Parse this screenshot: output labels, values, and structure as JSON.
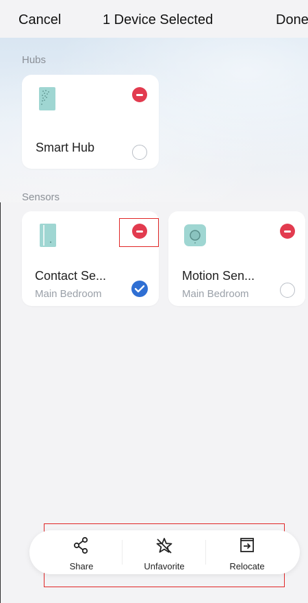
{
  "header": {
    "cancel_label": "Cancel",
    "title": "1 Device Selected",
    "done_label": "Done"
  },
  "sections": {
    "hubs_label": "Hubs",
    "sensors_label": "Sensors"
  },
  "devices": [
    {
      "name": "Smart Hub",
      "room": "",
      "selected": false,
      "icon": "hub-icon"
    },
    {
      "name": "Contact Se...",
      "room": "Main Bedroom",
      "selected": true,
      "icon": "contact-sensor-icon"
    },
    {
      "name": "Motion Sen...",
      "room": "Main Bedroom",
      "selected": false,
      "icon": "motion-sensor-icon"
    }
  ],
  "actions": [
    {
      "label": "Share",
      "icon": "share-icon"
    },
    {
      "label": "Unfavorite",
      "icon": "unfavorite-star-icon"
    },
    {
      "label": "Relocate",
      "icon": "relocate-icon"
    }
  ],
  "colors": {
    "remove": "#e23b4f",
    "selected_check": "#2f6fd3",
    "highlight": "#e02424"
  }
}
